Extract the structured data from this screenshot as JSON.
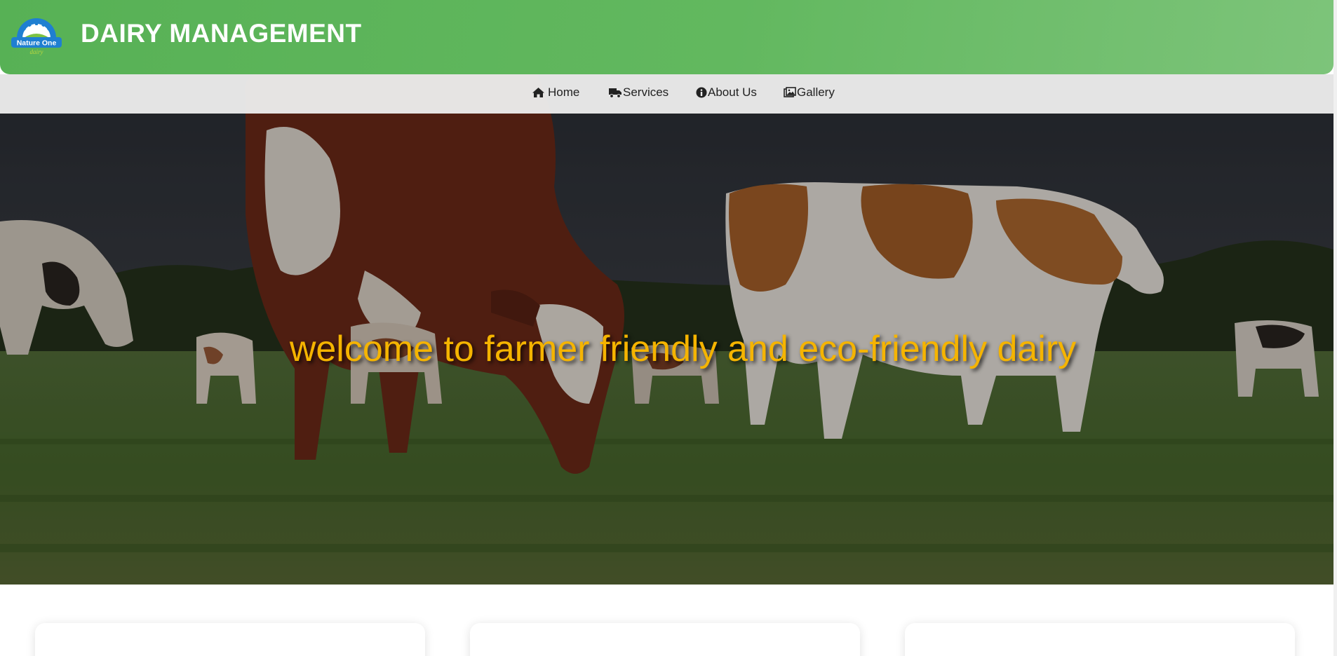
{
  "header": {
    "title": "DAIRY MANAGEMENT",
    "logo": {
      "name": "Nature One",
      "tagline": "dairy",
      "colors": {
        "blue": "#1f7fd1",
        "white": "#ffffff",
        "green": "#7cc243"
      }
    },
    "colors": {
      "background": "#5cb55a",
      "text": "#ffffff"
    }
  },
  "nav": {
    "items": [
      {
        "label": "Home",
        "icon": "home-icon"
      },
      {
        "label": "Services",
        "icon": "truck-icon"
      },
      {
        "label": "About Us",
        "icon": "info-circle-icon"
      },
      {
        "label": "Gallery",
        "icon": "images-icon"
      }
    ],
    "colors": {
      "background": "#ececec",
      "text": "#222222"
    }
  },
  "hero": {
    "heading": "welcome to farmer friendly and eco-friendly dairy",
    "background": "cows grazing in a green pasture",
    "colors": {
      "heading": "#f5b400"
    }
  },
  "cards": [
    {
      "id": "card-1"
    },
    {
      "id": "card-2"
    },
    {
      "id": "card-3"
    }
  ]
}
